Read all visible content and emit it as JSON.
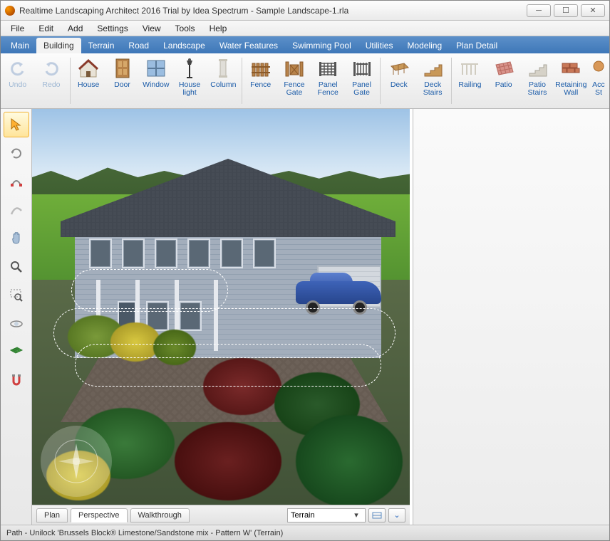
{
  "title": "Realtime Landscaping Architect 2016 Trial by Idea Spectrum - Sample Landscape-1.rla",
  "menu": [
    "File",
    "Edit",
    "Add",
    "Settings",
    "View",
    "Tools",
    "Help"
  ],
  "ribbon_tabs": [
    "Main",
    "Building",
    "Terrain",
    "Road",
    "Landscape",
    "Water Features",
    "Swimming Pool",
    "Utilities",
    "Modeling",
    "Plan Detail"
  ],
  "ribbon_active": 1,
  "ribbon": {
    "undo": "Undo",
    "redo": "Redo",
    "house": "House",
    "door": "Door",
    "window": "Window",
    "house_light": "House\nlight",
    "column": "Column",
    "fence": "Fence",
    "fence_gate": "Fence\nGate",
    "panel_fence": "Panel\nFence",
    "panel_gate": "Panel\nGate",
    "deck": "Deck",
    "deck_stairs": "Deck\nStairs",
    "railing": "Railing",
    "patio": "Patio",
    "patio_stairs": "Patio\nStairs",
    "retaining_wall": "Retaining\nWall",
    "accessory": "Acc\nSt"
  },
  "view_tabs": [
    "Plan",
    "Perspective",
    "Walkthrough"
  ],
  "view_active": 1,
  "layer_dropdown": "Terrain",
  "status": "Path - Unilock 'Brussels Block® Limestone/Sandstone mix - Pattern W' (Terrain)"
}
